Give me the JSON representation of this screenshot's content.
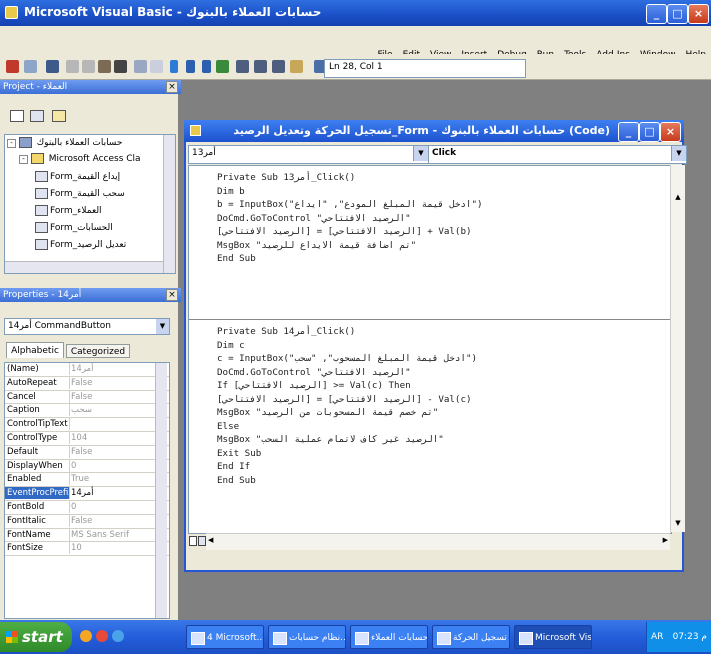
{
  "window": {
    "title": "Microsoft Visual Basic - حسابات العملاء بالبنوك",
    "minimize": "_",
    "maximize": "□",
    "close": "×"
  },
  "menu": {
    "items": [
      "Help",
      "Window",
      "Add-Ins",
      "Tools",
      "Run",
      "Debug",
      "Insert",
      "View",
      "Edit",
      "File"
    ]
  },
  "toolbar": {
    "position": "Ln 28, Col 1"
  },
  "project_panel": {
    "title": "Project - العملاء",
    "tree": {
      "root": "حسابات العملاء بالبنوك",
      "folder": "Microsoft Access Cla",
      "forms": [
        "Form_إيداع القيمة",
        "Form_سحب القيمة",
        "Form_العملاء",
        "Form_الحسابات",
        "Form_تعديل الرصيد"
      ]
    }
  },
  "properties_panel": {
    "title": "Properties - أمر14",
    "object_selector": "أمر14 CommandButton",
    "tabs": [
      "Alphabetic",
      "Categorized"
    ],
    "rows": [
      {
        "name": "(Name)",
        "value": "أمر14"
      },
      {
        "name": "AutoRepeat",
        "value": "False"
      },
      {
        "name": "Cancel",
        "value": "False"
      },
      {
        "name": "Caption",
        "value": "سحب"
      },
      {
        "name": "ControlTipText",
        "value": ""
      },
      {
        "name": "ControlType",
        "value": "104"
      },
      {
        "name": "Default",
        "value": "False"
      },
      {
        "name": "DisplayWhen",
        "value": "0"
      },
      {
        "name": "Enabled",
        "value": "True"
      },
      {
        "name": "EventProcPrefix",
        "value": "أمر14"
      },
      {
        "name": "FontBold",
        "value": "0"
      },
      {
        "name": "FontItalic",
        "value": "False"
      },
      {
        "name": "FontName",
        "value": "MS Sans Serif"
      },
      {
        "name": "FontSize",
        "value": "10"
      }
    ]
  },
  "code_window": {
    "title": "تسجيل الحركة وتعديل الرصيد_Form - حسابات العملاء بالبنوك (Code)",
    "object_combo": "أمر13",
    "proc_combo": "Click",
    "proc1": [
      "Private Sub أمر13_Click()",
      "Dim b",
      "b = InputBox(\"ادخل قيمة المبلغ المودع\", \"ايداع\")",
      "DoCmd.GoToControl \"الرصيد الافتتاحي\"",
      "[الرصيد الافتتاحي] = [الرصيد الافتتاحي] + Val(b)",
      "MsgBox \"تم اضافة قيمة الايداع للرصيد\"",
      "End Sub"
    ],
    "proc2": [
      "Private Sub أمر14_Click()",
      "Dim c",
      "c = InputBox(\"ادخل قيمة المبلغ المسحوب\", \"سحب\")",
      "DoCmd.GoToControl \"الرصيد الافتتاحي\"",
      "If [الرصيد الافتتاحي] >= Val(c) Then",
      "[الرصيد الافتتاحي] = [الرصيد الافتتاحي] - Val(c)",
      "MsgBox \"تم خصم قيمة المسحوبات من الرصيد\"",
      "Else",
      "MsgBox \"الرصيد غير كاف لاتمام عملية السحب\"",
      "Exit Sub",
      "End If",
      "End Sub"
    ]
  },
  "taskbar": {
    "start": "start",
    "tasks": [
      "4 Microsoft...",
      "نظام حسابات...",
      "حسابات العملاء",
      "تسجيل الحركة",
      "Microsoft Visu..."
    ],
    "lang": "AR",
    "clock": "07:23 م"
  },
  "colors": {
    "title_blue": "#1d52cf",
    "mdi_gray": "#808080",
    "chrome": "#ece9d8",
    "selection": "#316ac5"
  }
}
